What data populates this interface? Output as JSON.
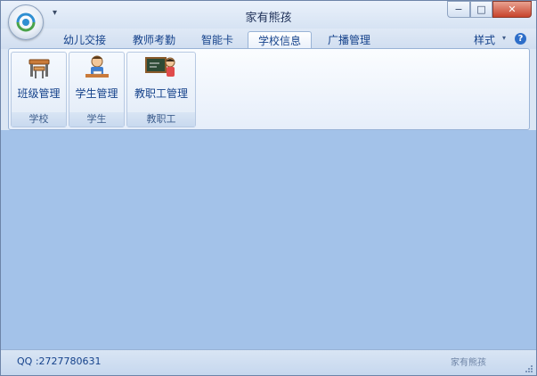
{
  "window": {
    "title": "家有熊孩",
    "qat_glyph": "▾",
    "min_glyph": "−",
    "max_glyph": "□",
    "close_glyph": "✕"
  },
  "tabs": [
    {
      "label": "幼儿交接",
      "active": false
    },
    {
      "label": "教师考勤",
      "active": false
    },
    {
      "label": "智能卡",
      "active": false
    },
    {
      "label": "学校信息",
      "active": true
    },
    {
      "label": "广播管理",
      "active": false
    }
  ],
  "style_menu": {
    "label": "样式",
    "arrow": "▾"
  },
  "help": {
    "glyph": "?"
  },
  "groups": [
    {
      "title": "学校",
      "button": {
        "label": "班级管理",
        "icon": "classroom-desk-icon"
      }
    },
    {
      "title": "学生",
      "button": {
        "label": "学生管理",
        "icon": "student-icon"
      }
    },
    {
      "title": "教职工",
      "button": {
        "label": "教职工管理",
        "icon": "teacher-blackboard-icon"
      }
    }
  ],
  "statusbar": {
    "text": "QQ :2727780631",
    "right_text": "家有熊孩"
  },
  "colors": {
    "workspace": "#a3c2e9",
    "ribbon_text": "#15428b",
    "close_button": "#c7432b"
  }
}
